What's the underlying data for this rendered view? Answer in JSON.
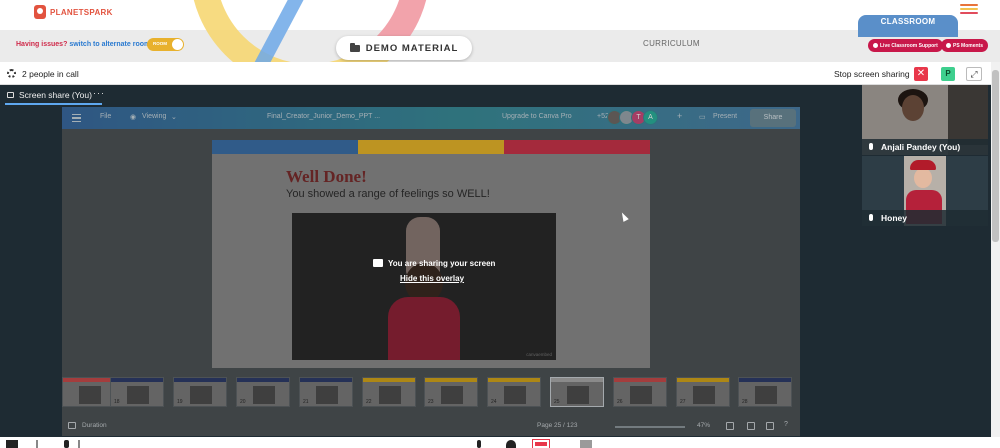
{
  "brand": {
    "logo_text": "PLANETSPARK",
    "accent": "#e2533f"
  },
  "header": {
    "issue_prefix": "Having issues?",
    "issue_link": "switch to alternate room",
    "toggle_label": "ROOM",
    "demo_material": "DEMO MATERIAL",
    "curriculum": "CURRICULUM",
    "classroom_tab": "CLASSROOM",
    "live_support": "Live Classroom Support",
    "ps_moments": "PS Moments",
    "menu_colors": [
      "#e8743b",
      "#f2c14e",
      "#e14c5c"
    ]
  },
  "call": {
    "people": "2 people in call",
    "stop_sharing": "Stop screen sharing",
    "stop_icon": "✕",
    "presenter_initial": "P",
    "expand_icon": "⤢"
  },
  "share": {
    "tab_label": "Screen share (You)",
    "more": "···",
    "overlay_text": "You are sharing your screen",
    "hide_overlay": "Hide this overlay"
  },
  "canva": {
    "file": "File",
    "viewing": "Viewing",
    "doc_title": "Final_Creator_Junior_Demo_PPT ...",
    "upgrade": "Upgrade to Canva Pro",
    "collab_count": "+52",
    "avatar_t": "T",
    "avatar_a": "A",
    "plus": "+",
    "present": "Present",
    "share": "Share",
    "slide_title": "Well Done!",
    "slide_subtitle": "You showed a range of feelings so WELL!",
    "watermark": "canvaembed",
    "duration": "Duration",
    "page": "Page 25 / 123",
    "zoom": "47%",
    "help": "?",
    "slide_bar_colors": [
      "#3b6fa8",
      "#e7b52a",
      "#c9344a"
    ]
  },
  "thumbs": [
    {
      "num": "",
      "color": "#c94b4b"
    },
    {
      "num": "18",
      "color": "#2e3c6b"
    },
    {
      "num": "19",
      "color": "#2e3c6b"
    },
    {
      "num": "20",
      "color": "#2e3c6b"
    },
    {
      "num": "21",
      "color": "#2e3c6b"
    },
    {
      "num": "22",
      "color": "#d4a51a"
    },
    {
      "num": "23",
      "color": "#d4a51a"
    },
    {
      "num": "24",
      "color": "#d4a51a"
    },
    {
      "num": "25",
      "color": "#a9a9a9"
    },
    {
      "num": "26",
      "color": "#c94b4b"
    },
    {
      "num": "27",
      "color": "#d4a51a"
    },
    {
      "num": "28",
      "color": "#2e3c6b"
    }
  ],
  "participants": [
    {
      "name": "Anjali Pandey (You)"
    },
    {
      "name": "Honey"
    }
  ]
}
